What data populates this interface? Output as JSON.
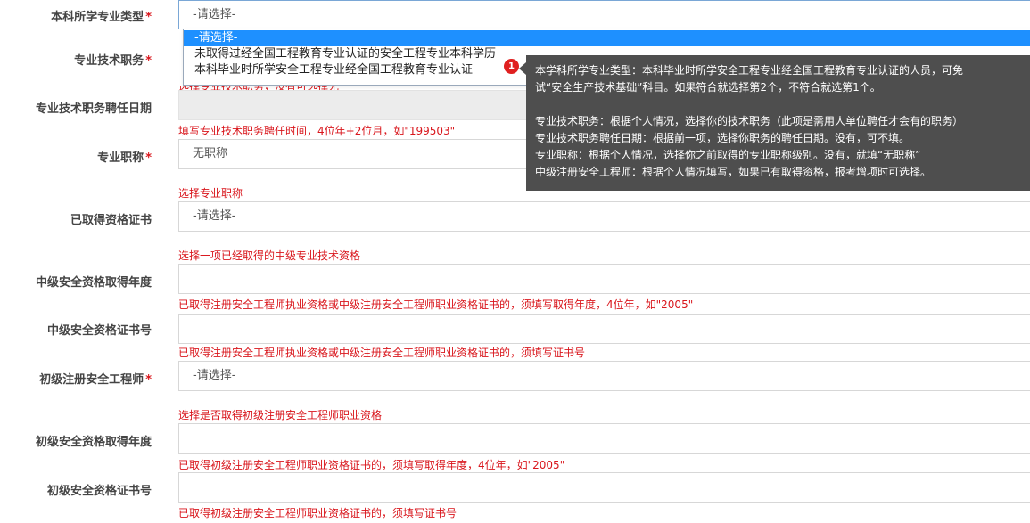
{
  "rows": [
    {
      "label": "本科所学专业类型",
      "required": true,
      "value": "-请选择-",
      "hint": ""
    },
    {
      "label": "专业技术职务",
      "required": true,
      "value": "",
      "hint": "选择专业技术职务，没有可选择无"
    },
    {
      "label": "专业技术职务聘任日期",
      "required": false,
      "value": "",
      "hint": "填写专业技术职务聘任时间，4位年+2位月，如\"199503\""
    },
    {
      "label": "专业职称",
      "required": true,
      "value": "无职称",
      "hint": "选择专业职称"
    },
    {
      "label": "已取得资格证书",
      "required": false,
      "value": "-请选择-",
      "hint": "选择一项已经取得的中级专业技术资格"
    },
    {
      "label": "中级安全资格取得年度",
      "required": false,
      "value": "",
      "hint": "已取得注册安全工程师执业资格或中级注册安全工程师职业资格证书的，须填写取得年度，4位年，如\"2005\""
    },
    {
      "label": "中级安全资格证书号",
      "required": false,
      "value": "",
      "hint": "已取得注册安全工程师执业资格或中级注册安全工程师职业资格证书的，须填写证书号"
    },
    {
      "label": "初级注册安全工程师",
      "required": true,
      "value": "-请选择-",
      "hint": "选择是否取得初级注册安全工程师职业资格"
    },
    {
      "label": "初级安全资格取得年度",
      "required": false,
      "value": "",
      "hint": "已取得初级注册安全工程师职业资格证书的，须填写取得年度，4位年，如\"2005\""
    },
    {
      "label": "初级安全资格证书号",
      "required": false,
      "value": "",
      "hint": "已取得初级注册安全工程师职业资格证书的，须填写证书号"
    }
  ],
  "required_mark": "*",
  "dropdown": {
    "options": [
      "-请选择-",
      "未取得过经全国工程教育专业认证的安全工程专业本科学历",
      "本科毕业时所学安全工程专业经全国工程教育专业认证"
    ],
    "selected_index": 0
  },
  "badge": "1",
  "tooltip": {
    "lines": [
      "本学科所学专业类型：本科毕业时所学安全工程专业经全国工程教育专业认证的人员，可免",
      "试“安全生产技术基础”科目。如果符合就选择第2个，不符合就选第1个。",
      "",
      "专业技术职务：根据个人情况，选择你的技术职务（此项是需用人单位聘任才会有的职务）",
      "专业技术职务聘任日期：根据前一项，选择你职务的聘任日期。没有，可不填。",
      "专业职称：根据个人情况，选择你之前取得的专业职称级别。没有，就填“无职称”",
      "中级注册安全工程师：根据个人情况填写，如果已有取得资格，报考增项时可选择。"
    ]
  },
  "colors": {
    "hint": "#d9161c",
    "selected_option": "#1e90ff",
    "tooltip_bg": "#4e4e4e",
    "badge": "#e02020"
  }
}
